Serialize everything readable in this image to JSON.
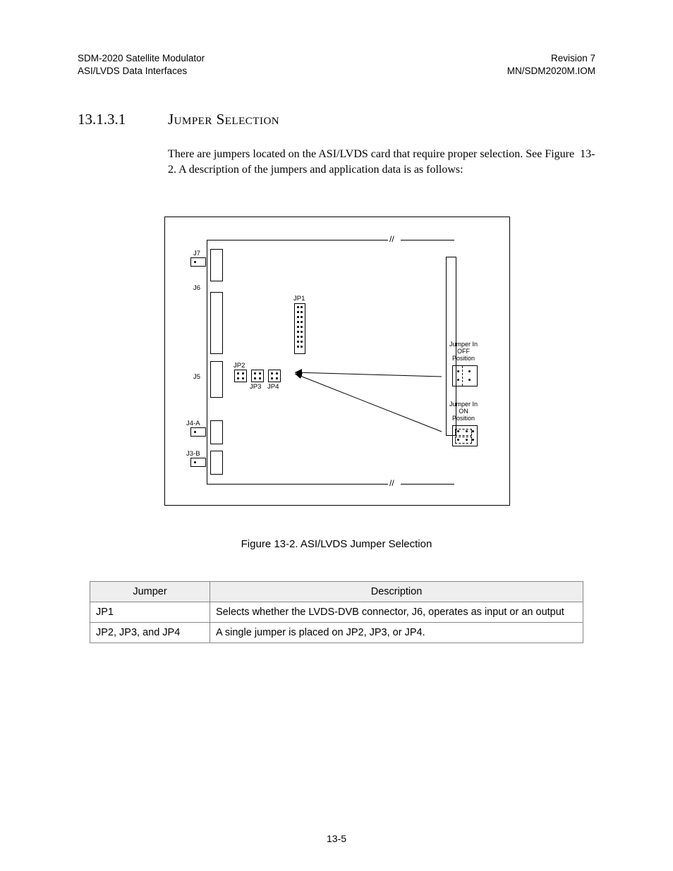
{
  "header": {
    "left_line1": "SDM-2020 Satellite Modulator",
    "left_line2": "ASI/LVDS Data Interfaces",
    "right_line1": "Revision 7",
    "right_line2": "MN/SDM2020M.IOM"
  },
  "section": {
    "number": "13.1.3.1",
    "title_word1": "Jumper",
    "title_word2": "Selection"
  },
  "paragraph": "There are jumpers located on the ASI/LVDS card that require proper selection. See Figure  13-2. A description of the jumpers and application data is as follows:",
  "figure": {
    "caption": "Figure 13-2. ASI/LVDS Jumper Selection",
    "labels": {
      "j7": "J7",
      "j6": "J6",
      "j5": "J5",
      "j4a": "J4-A",
      "j3b": "J3-B",
      "jp1": "JP1",
      "jp2": "JP2",
      "jp3": "JP3",
      "jp4": "JP4",
      "off1": "Jumper In",
      "off2": "OFF",
      "off3": "Position",
      "on1": "Jumper In",
      "on2": "ON",
      "on3": "Position"
    }
  },
  "table": {
    "headers": {
      "col1": "Jumper",
      "col2": "Description"
    },
    "rows": [
      {
        "jumper": "JP1",
        "desc": "Selects whether the LVDS-DVB connector, J6, operates as input or an output"
      },
      {
        "jumper": "JP2, JP3, and JP4",
        "desc": "A single jumper is placed on JP2, JP3, or JP4."
      }
    ]
  },
  "page_number": "13-5"
}
